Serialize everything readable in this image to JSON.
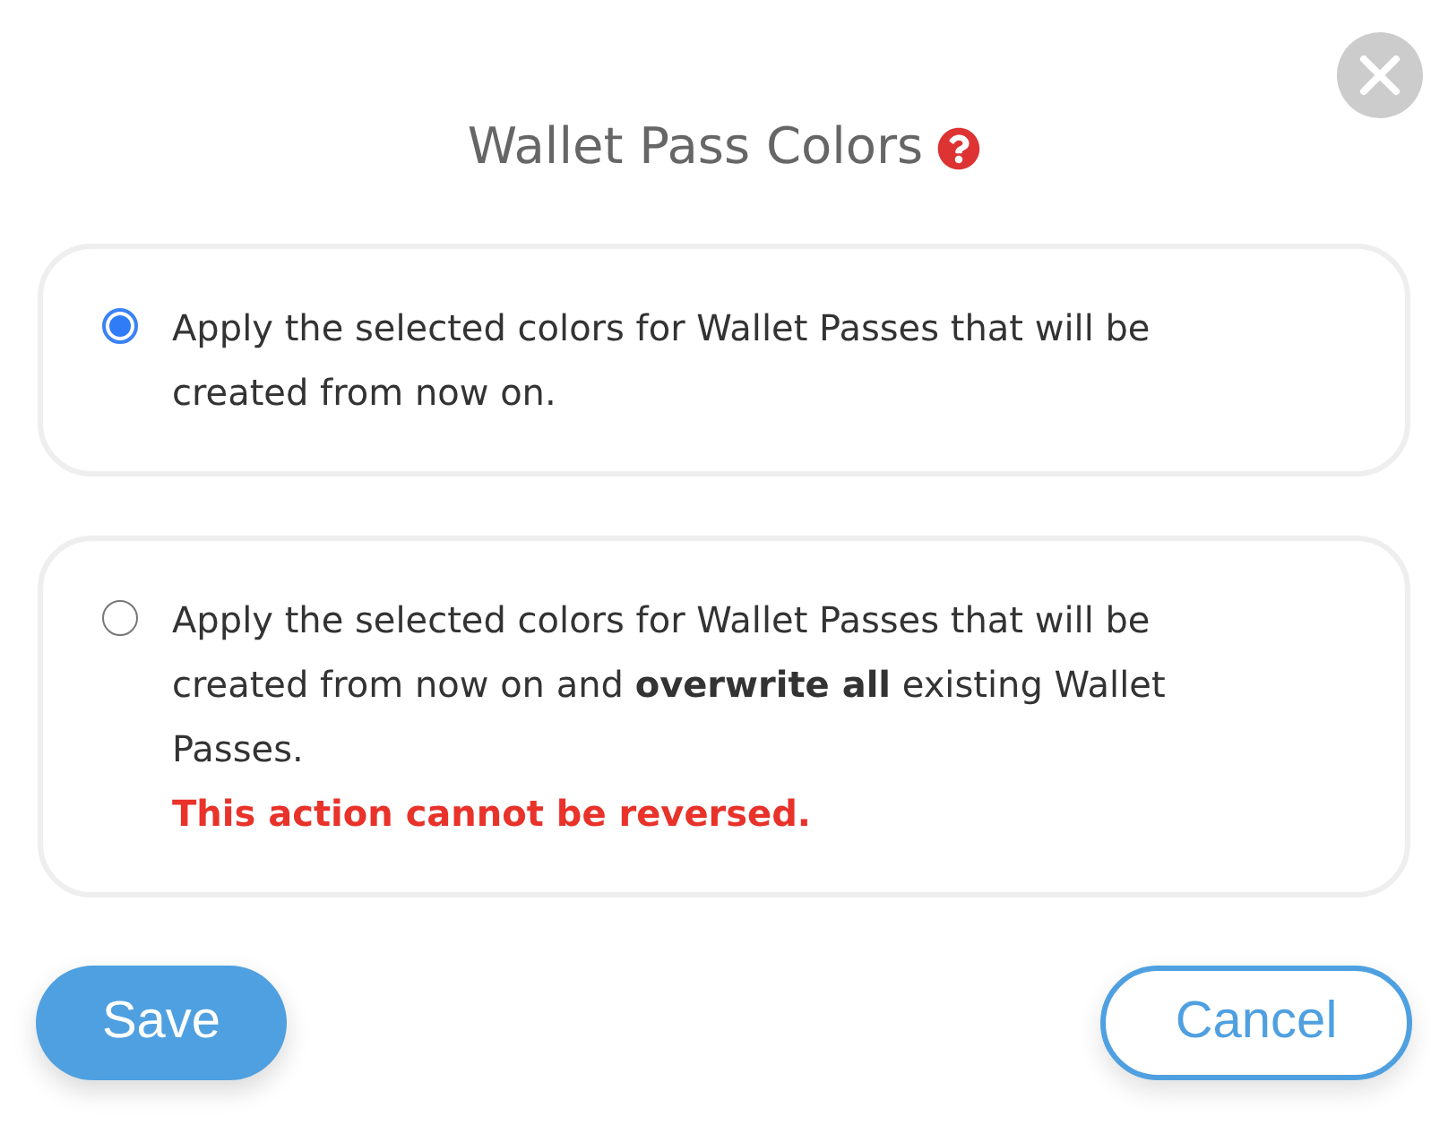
{
  "dialog": {
    "title": "Wallet Pass Colors"
  },
  "options": [
    {
      "text": "Apply the selected colors for Wallet Passes that will be created from now on.",
      "selected": true
    },
    {
      "text": "Apply the selected colors for Wallet Passes that will be created from now on and **overwrite all** existing Wallet Passes.",
      "warning": "This action cannot be reversed.",
      "selected": false
    }
  ],
  "buttons": [
    {
      "label": "Save",
      "kind": "primary"
    },
    {
      "label": "Cancel",
      "kind": "secondary"
    }
  ]
}
